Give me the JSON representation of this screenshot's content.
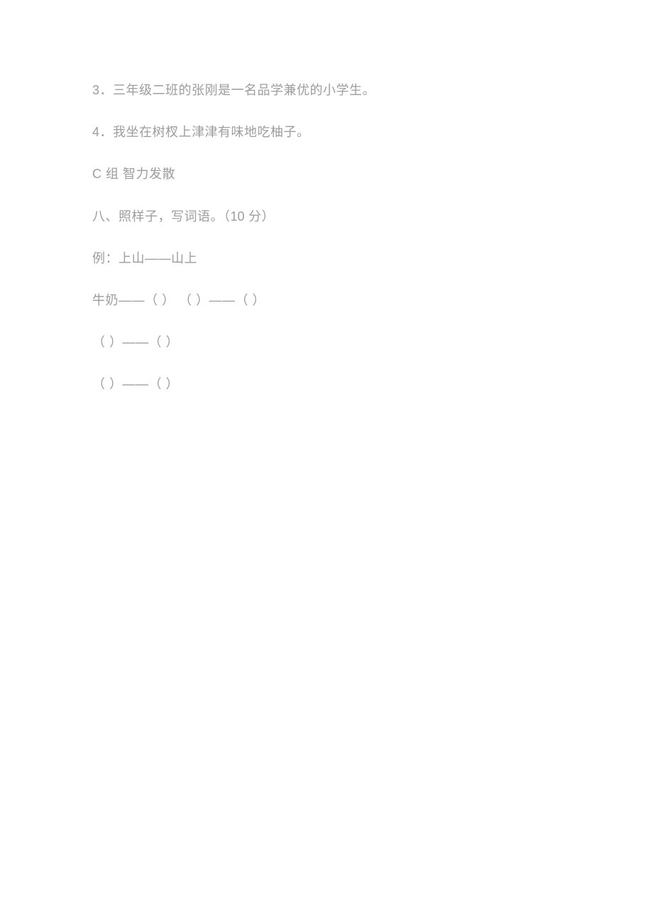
{
  "lines": {
    "l1": "3．三年级二班的张刚是一名品学兼优的小学生。",
    "l2": "4．我坐在树杈上津津有味地吃柚子。",
    "l3_prefix": "C",
    "l3_rest": " 组 智力发散",
    "l4_a": "八、照样子，写词语。（",
    "l4_b": "10",
    "l4_c": " 分）",
    "l5": "例：上山——山上",
    "l6": "牛奶——（ ）  （ ）——（ ）",
    "l7": "（ ）——（ ）",
    "l8": "（ ）——（ ）"
  }
}
